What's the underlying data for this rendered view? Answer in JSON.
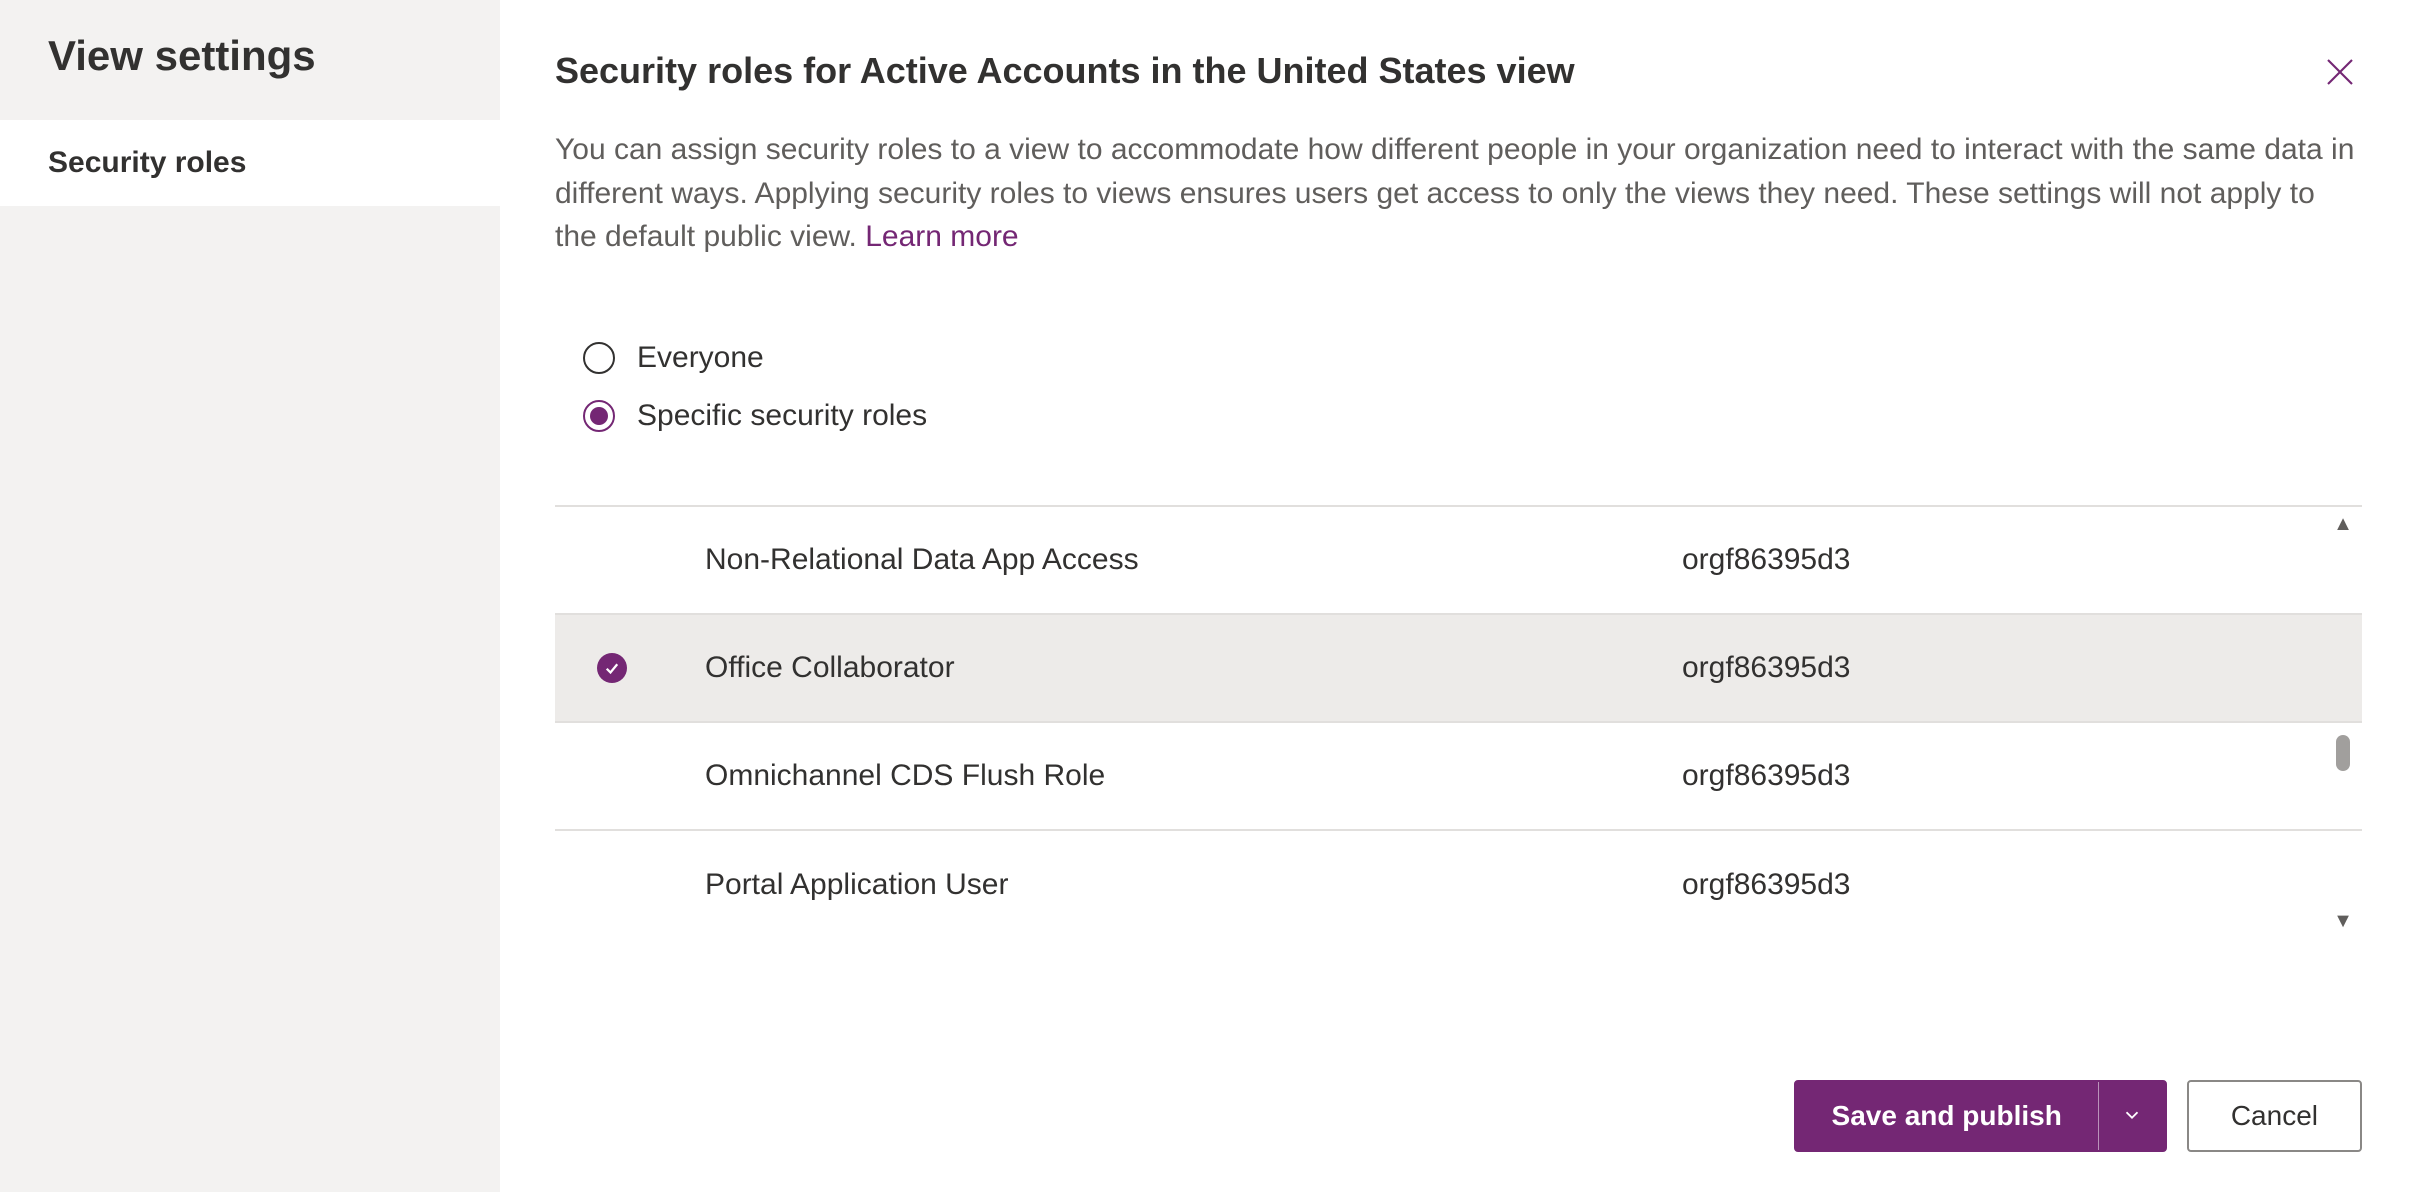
{
  "sidebar": {
    "title": "View settings",
    "items": [
      {
        "label": "Security roles",
        "active": true
      }
    ]
  },
  "header": {
    "title": "Security roles for Active Accounts in the United States view"
  },
  "description": {
    "text": "You can assign security roles to a view to accommodate how different people in your organization need to interact with the same data in different ways. Applying security roles to views ensures users get access to only the views they need. These settings will not apply to the default public view. ",
    "link_label": "Learn more"
  },
  "scope": {
    "options": [
      {
        "label": "Everyone",
        "selected": false
      },
      {
        "label": "Specific security roles",
        "selected": true
      }
    ]
  },
  "roles": [
    {
      "name": "Non-Relational Data App Access",
      "org": "orgf86395d3",
      "selected": false
    },
    {
      "name": "Office Collaborator",
      "org": "orgf86395d3",
      "selected": true
    },
    {
      "name": "Omnichannel CDS Flush Role",
      "org": "orgf86395d3",
      "selected": false
    },
    {
      "name": "Portal Application User",
      "org": "orgf86395d3",
      "selected": false
    }
  ],
  "footer": {
    "primary_label": "Save and publish",
    "secondary_label": "Cancel"
  },
  "colors": {
    "accent": "#742774"
  }
}
